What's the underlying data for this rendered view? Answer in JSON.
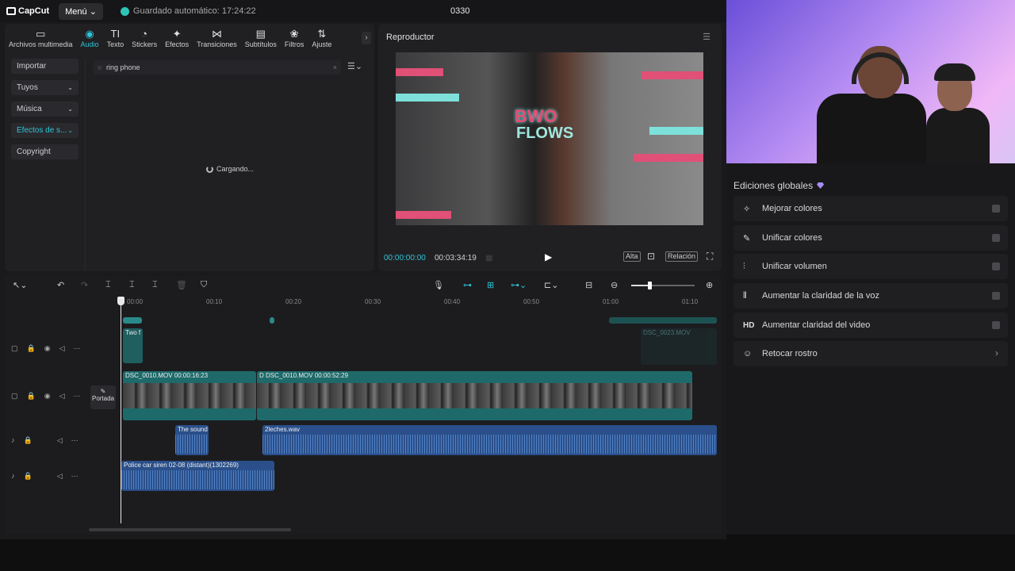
{
  "topbar": {
    "logo": "CapCut",
    "menu_label": "Menú",
    "autosave": "Guardado automático: 17:24:22",
    "project_title": "0330"
  },
  "tabs": [
    {
      "label": "Archivos multimedia",
      "icon": "media-icon"
    },
    {
      "label": "Audio",
      "icon": "audio-icon"
    },
    {
      "label": "Texto",
      "icon": "text-icon"
    },
    {
      "label": "Stickers",
      "icon": "stickers-icon"
    },
    {
      "label": "Efectos",
      "icon": "effects-icon"
    },
    {
      "label": "Transiciones",
      "icon": "transitions-icon"
    },
    {
      "label": "Subtítulos",
      "icon": "subtitles-icon"
    },
    {
      "label": "Filtros",
      "icon": "filters-icon"
    },
    {
      "label": "Ajuste",
      "icon": "adjust-icon"
    }
  ],
  "side_menu": [
    "Importar",
    "Tuyos",
    "Música",
    "Efectos de s...",
    "Copyright"
  ],
  "search": {
    "value": "ring phone"
  },
  "loading_text": "Cargando...",
  "player": {
    "title": "Reproductor",
    "current_time": "00:00:00:00",
    "total_time": "00:03:34:19",
    "quality_label": "Alta",
    "ratio_label": "Relación",
    "video_text_top": "BWO",
    "video_text_bottom": "FLOWS"
  },
  "ruler_ticks": [
    "00:00",
    "00:10",
    "00:20",
    "00:30",
    "00:40",
    "00:50",
    "01:00",
    "01:10"
  ],
  "timeline": {
    "cover_label": "Portada",
    "text_clip": "Two f",
    "faded_clip": "DSC_0023.MOV",
    "video_clip_1": "DSC_0010.MOV  00:00:16:23",
    "video_clip_2": "DSC_0010.MOV  00:00:52:29",
    "video_clip_2_prefix": "D",
    "audio_clip_1": "The sound",
    "audio_clip_2": "2leches.wav",
    "audio_clip_3": "Police car siren 02-08 (distant)(1302269)"
  },
  "global_edits": {
    "title": "Ediciones globales",
    "items": [
      {
        "label": "Mejorar colores",
        "icon": "magic-wand-icon"
      },
      {
        "label": "Unificar colores",
        "icon": "palette-icon"
      },
      {
        "label": "Unificar volumen",
        "icon": "sliders-icon"
      },
      {
        "label": "Aumentar la claridad de la voz",
        "icon": "voice-wave-icon"
      },
      {
        "label": "Aumentar claridad del video",
        "icon": "hd-icon"
      },
      {
        "label": "Retocar rostro",
        "icon": "face-retouch-icon"
      }
    ]
  },
  "colors": {
    "accent": "#2ec4d6",
    "video_track": "#1e6a6a",
    "audio_track": "#2a4f8a"
  }
}
